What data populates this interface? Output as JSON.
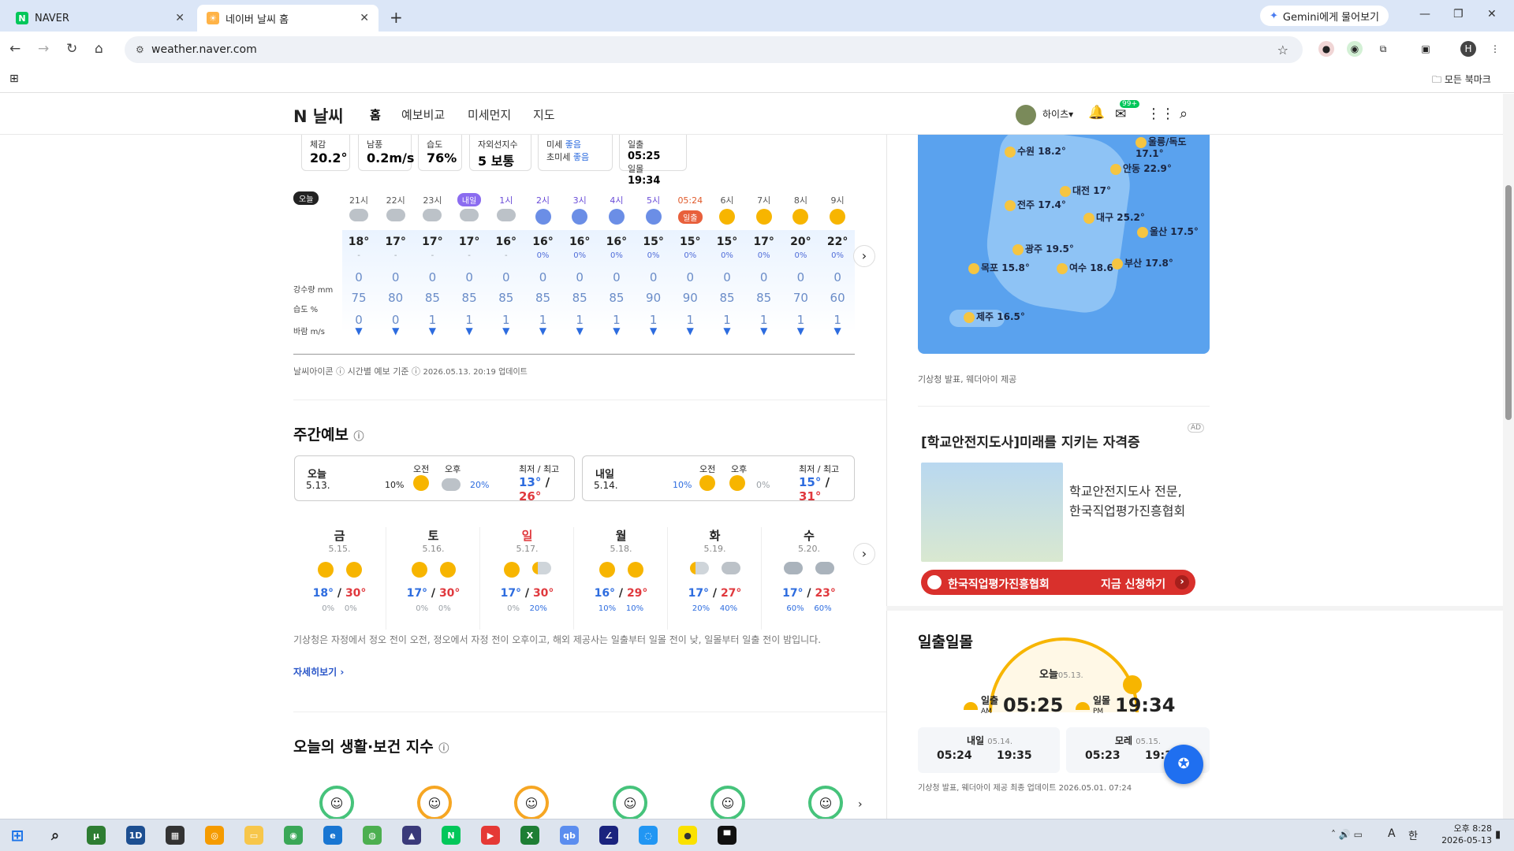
{
  "browser": {
    "tabs": [
      {
        "label": "NAVER"
      },
      {
        "label": "네이버 날씨 홈"
      }
    ],
    "gemini": "Gemini에게 물어보기",
    "url": "weather.naver.com",
    "bookmarks": "모든 북마크"
  },
  "header": {
    "logo_n": "N",
    "logo_text": "날씨",
    "menu": [
      "홈",
      "예보비교",
      "미세먼지",
      "지도"
    ],
    "user": "하이츠",
    "mail_badge": "99+"
  },
  "summary": [
    {
      "label": "체감",
      "value": "20.2°"
    },
    {
      "label": "남풍",
      "value": "0.2m/s"
    },
    {
      "label": "습도",
      "value": "76%"
    },
    {
      "label": "자외선지수",
      "value": "5 보통"
    },
    {
      "label1": "미세",
      "val1": "좋음",
      "label2": "초미세",
      "val2": "좋음"
    },
    {
      "label1": "일출",
      "val1": "05:25",
      "label2": "일몰",
      "val2": "19:34"
    }
  ],
  "hourly": {
    "today_badge": "오늘",
    "sunrise_badge": "일출",
    "row_labels": {
      "rain": "강수량 mm",
      "humidity": "습도 %",
      "wind": "바람 m/s"
    },
    "hours": [
      {
        "time": "21시",
        "icon": "cloud",
        "temp": "18°",
        "pop": "-",
        "rain": "0",
        "hum": "75",
        "wind": "0"
      },
      {
        "time": "22시",
        "icon": "cloud",
        "temp": "17°",
        "pop": "-",
        "rain": "0",
        "hum": "80",
        "wind": "0"
      },
      {
        "time": "23시",
        "icon": "cloud",
        "temp": "17°",
        "pop": "-",
        "rain": "0",
        "hum": "85",
        "wind": "1"
      },
      {
        "time": "내일",
        "icon": "cloud",
        "temp": "17°",
        "pop": "-",
        "rain": "0",
        "hum": "85",
        "wind": "1"
      },
      {
        "time": "1시",
        "icon": "cloud",
        "temp": "16°",
        "pop": "-",
        "rain": "0",
        "hum": "85",
        "wind": "1"
      },
      {
        "time": "2시",
        "icon": "moon",
        "temp": "16°",
        "pop": "0%",
        "rain": "0",
        "hum": "85",
        "wind": "1"
      },
      {
        "time": "3시",
        "icon": "moon",
        "temp": "16°",
        "pop": "0%",
        "rain": "0",
        "hum": "85",
        "wind": "1"
      },
      {
        "time": "4시",
        "icon": "moon",
        "temp": "16°",
        "pop": "0%",
        "rain": "0",
        "hum": "85",
        "wind": "1"
      },
      {
        "time": "5시",
        "icon": "moon",
        "temp": "15°",
        "pop": "0%",
        "rain": "0",
        "hum": "90",
        "wind": "1"
      },
      {
        "time": "05:24",
        "icon": "sunrise",
        "temp": "15°",
        "pop": "0%",
        "rain": "0",
        "hum": "90",
        "wind": "1"
      },
      {
        "time": "6시",
        "icon": "sun",
        "temp": "15°",
        "pop": "0%",
        "rain": "0",
        "hum": "85",
        "wind": "1"
      },
      {
        "time": "7시",
        "icon": "sun",
        "temp": "17°",
        "pop": "0%",
        "rain": "0",
        "hum": "85",
        "wind": "1"
      },
      {
        "time": "8시",
        "icon": "sun",
        "temp": "20°",
        "pop": "0%",
        "rain": "0",
        "hum": "70",
        "wind": "1"
      },
      {
        "time": "9시",
        "icon": "sun",
        "temp": "22°",
        "pop": "0%",
        "rain": "0",
        "hum": "60",
        "wind": "1"
      }
    ],
    "footer_icon": "날씨아이콘",
    "footer_basis": "시간별 예보 기준",
    "footer_update": "2026.05.13. 20:19 업데이트"
  },
  "weekly": {
    "title": "주간예보",
    "am": "오전",
    "pm": "오후",
    "minmax": "최저 / 최고",
    "today": {
      "day": "오늘",
      "date": "5.13.",
      "am_pop": "10%",
      "pm_pop": "20%",
      "min": "13°",
      "max": "26°"
    },
    "tomorrow": {
      "day": "내일",
      "date": "5.14.",
      "am_pop": "10%",
      "pm_pop": "0%",
      "min": "15°",
      "max": "31°"
    },
    "days": [
      {
        "day": "금",
        "date": "5.15.",
        "min": "18°",
        "max": "30°",
        "am": "0%",
        "pm": "0%",
        "icon_am": "sun",
        "icon_pm": "sun"
      },
      {
        "day": "토",
        "date": "5.16.",
        "min": "17°",
        "max": "30°",
        "am": "0%",
        "pm": "0%",
        "icon_am": "sun",
        "icon_pm": "sun"
      },
      {
        "day": "일",
        "date": "5.17.",
        "min": "17°",
        "max": "30°",
        "am": "0%",
        "pm": "20%",
        "icon_am": "sun",
        "icon_pm": "suncloud"
      },
      {
        "day": "월",
        "date": "5.18.",
        "min": "16°",
        "max": "29°",
        "am": "10%",
        "pm": "10%",
        "icon_am": "sun",
        "icon_pm": "sun"
      },
      {
        "day": "화",
        "date": "5.19.",
        "min": "17°",
        "max": "27°",
        "am": "20%",
        "pm": "40%",
        "icon_am": "suncloud",
        "icon_pm": "cloud"
      },
      {
        "day": "수",
        "date": "5.20.",
        "min": "17°",
        "max": "23°",
        "am": "60%",
        "pm": "60%",
        "icon_am": "rain",
        "icon_pm": "rain"
      }
    ],
    "note": "기상청은 자정에서 정오 전이 오전, 정오에서 자정 전이 오후이고, 해외 제공사는 일출부터 일몰 전이 낮, 일몰부터 일출 전이 밤입니다.",
    "more": "자세히보기"
  },
  "life": {
    "title": "오늘의 생활·보건 지수"
  },
  "map": {
    "cities": [
      {
        "name": "수원",
        "temp": "18.2°"
      },
      {
        "name": "울릉/독도",
        "temp": "17.1°"
      },
      {
        "name": "안동",
        "temp": "22.9°"
      },
      {
        "name": "대전",
        "temp": "17°"
      },
      {
        "name": "전주",
        "temp": "17.4°"
      },
      {
        "name": "대구",
        "temp": "25.2°"
      },
      {
        "name": "울산",
        "temp": "17.5°"
      },
      {
        "name": "광주",
        "temp": "19.5°"
      },
      {
        "name": "목포",
        "temp": "15.8°"
      },
      {
        "name": "여수",
        "temp": "18.6°"
      },
      {
        "name": "부산",
        "temp": "17.8°"
      },
      {
        "name": "제주",
        "temp": "16.5°"
      }
    ],
    "source": "기상청 발표, 웨더아이 제공"
  },
  "ad": {
    "badge": "AD",
    "title": "[학교안전지도사]미래를 지키는 자격증",
    "text": "학교안전지도사 전문, 한국직업평가진흥협회",
    "org": "한국직업평가진흥협회",
    "cta": "지금 신청하기"
  },
  "sun": {
    "title": "일출일몰",
    "today": "오늘",
    "today_date": "05.13.",
    "sunrise_label": "일출",
    "am": "AM",
    "sunrise": "05:25",
    "sunset_label": "일몰",
    "pm": "PM",
    "sunset": "19:34",
    "tomorrow": "내일",
    "tomorrow_date": "05.14.",
    "t_rise": "05:24",
    "t_set": "19:35",
    "dayafter": "모레",
    "dayafter_date": "05.15.",
    "d_rise": "05:23",
    "d_set": "19:36",
    "source": "기상청 발표, 웨더아이 제공 최종 업데이트 2026.05.01. 07:24"
  },
  "taskbar": {
    "time": "오후 8:28",
    "date": "2026-05-13",
    "ime": "한",
    "font_a": "A"
  }
}
